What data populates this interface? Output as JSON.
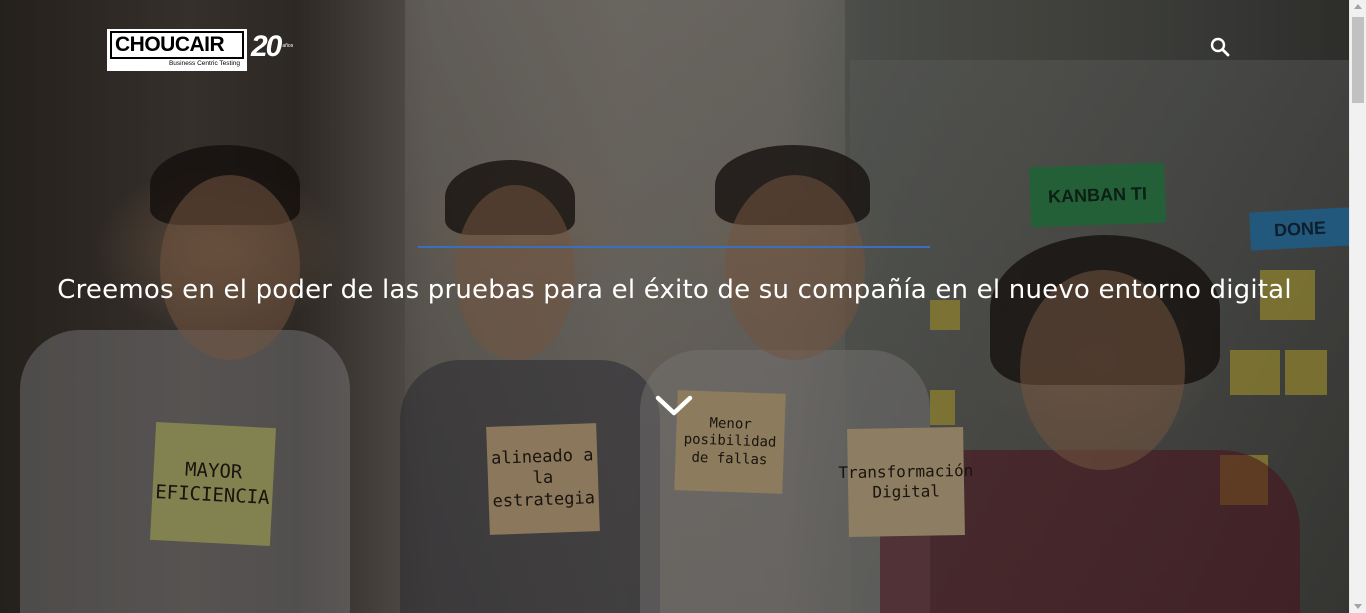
{
  "header": {
    "logo_text": "CHOUCAIR",
    "logo_tagline": "Business Centric Testing",
    "logo_years": "20",
    "logo_years_sub": "años",
    "search_icon": "search-icon"
  },
  "hero": {
    "title": "Creemos en el poder de las pruebas para el éxito de su compañía en el nuevo entorno digital",
    "scroll_icon": "chevron-down-icon",
    "accent_line_color": "#3a6fbf"
  },
  "photo": {
    "notes": [
      "MAYOR EFICIENCIA",
      "alineado a la estrategia",
      "Menor posibilidad de fallas",
      "Transformación Digital"
    ],
    "board_labels": [
      "KANBAN TI",
      "DONE"
    ]
  },
  "colors": {
    "overlay": "rgba(0,0,0,0.40)",
    "text": "#ffffff"
  }
}
